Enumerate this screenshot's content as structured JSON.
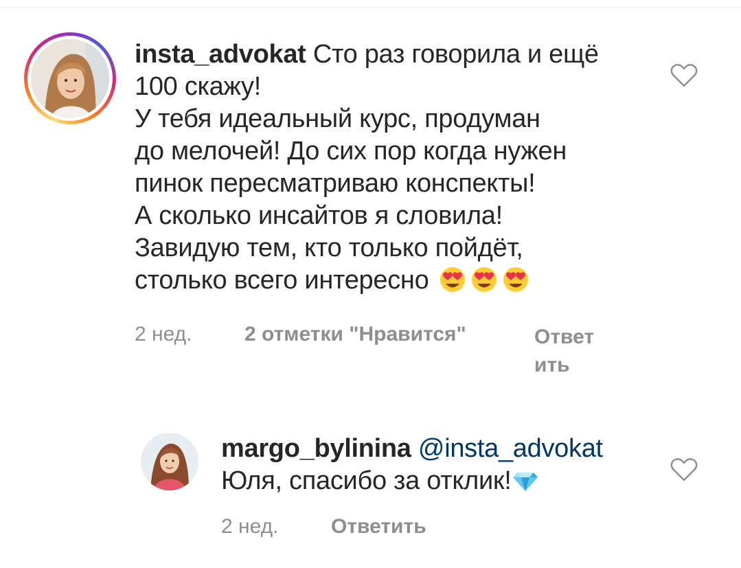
{
  "comments": [
    {
      "username": "insta_advokat",
      "text_lines": [
        "Сто раз говорила и ещё",
        "100 скажу!",
        "У тебя идеальный курс, продуман",
        "до мелочей! До сих пор когда нужен",
        "пинок пересматриваю конспекты!",
        "А сколько инсайтов я словила!",
        "Завидую тем, кто только пойдёт,",
        "столько всего интересно"
      ],
      "emoji": [
        "heart-eyes-emoji",
        "heart-eyes-emoji",
        "heart-eyes-emoji"
      ],
      "time": "2 нед.",
      "likes": "2 отметки \"Нравится\"",
      "reply_line1": "Ответ",
      "reply_line2": "ить",
      "like_icon": "heart-outline-icon"
    },
    {
      "username": "margo_bylinina",
      "mention": "@insta_advokat",
      "text": "Юля, спасибо за отклик!",
      "emoji": [
        "diamond-emoji"
      ],
      "time": "2 нед.",
      "reply": "Ответить",
      "like_icon": "heart-outline-icon"
    }
  ],
  "colors": {
    "text": "#262626",
    "secondary": "#8e8e8e",
    "mention": "#00376b"
  }
}
